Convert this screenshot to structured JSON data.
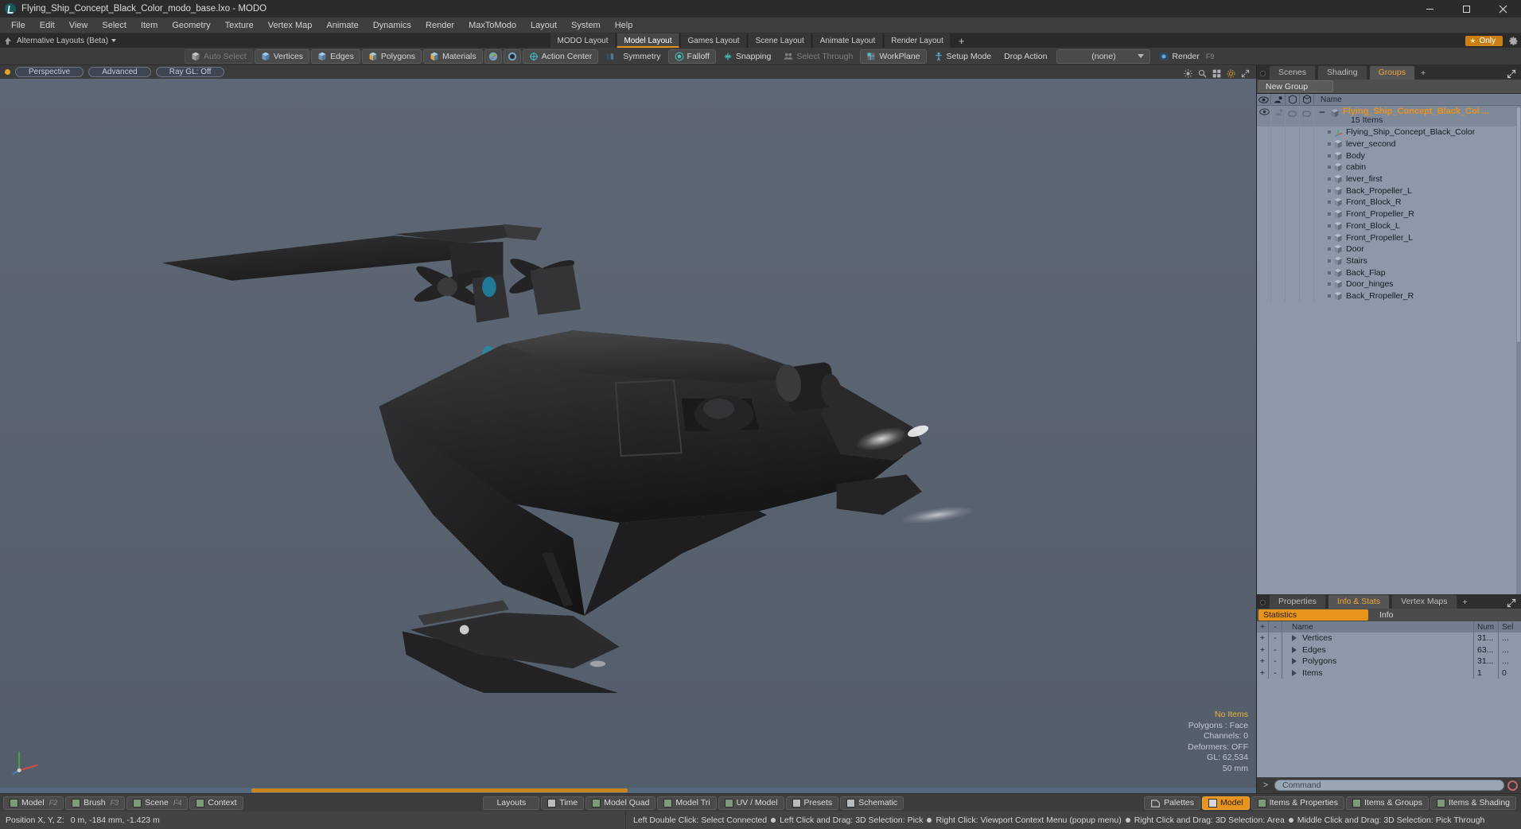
{
  "titlebar": {
    "title": "Flying_Ship_Concept_Black_Color_modo_base.lxo - MODO",
    "minimize": "—",
    "maximize": "❐",
    "close": "✕"
  },
  "menubar": {
    "items": [
      "File",
      "Edit",
      "View",
      "Select",
      "Item",
      "Geometry",
      "Texture",
      "Vertex Map",
      "Animate",
      "Dynamics",
      "Render",
      "MaxToModo",
      "Layout",
      "System",
      "Help"
    ]
  },
  "layoutbar": {
    "alt_layouts": "Alternative Layouts (Beta)",
    "tabs": [
      {
        "label": "MODO Layout",
        "active": false
      },
      {
        "label": "Model Layout",
        "active": true
      },
      {
        "label": "Games Layout",
        "active": false
      },
      {
        "label": "Scene Layout",
        "active": false
      },
      {
        "label": "Animate Layout",
        "active": false
      },
      {
        "label": "Render Layout",
        "active": false
      }
    ],
    "add_tab": "+",
    "only_label": "Only",
    "accent": "#e8901a"
  },
  "modebar": {
    "buttons": [
      {
        "label": "Auto Select",
        "dim": true,
        "icon": "cube-grey-icon"
      },
      {
        "label": "Vertices",
        "dim": false,
        "icon": "cube-blue-icon"
      },
      {
        "label": "Edges",
        "dim": false,
        "icon": "cube-blue-icon"
      },
      {
        "label": "Polygons",
        "dim": false,
        "icon": "cube-blue-icon"
      },
      {
        "label": "Materials",
        "dim": false,
        "icon": "cube-blue-icon"
      }
    ],
    "small_icons": [
      "sphere-red-icon",
      "sphere-dark-icon"
    ],
    "action_center": "Action Center",
    "symmetry": "Symmetry",
    "falloff": "Falloff",
    "snapping": "Snapping",
    "select_through": "Select Through",
    "workplane": "WorkPlane",
    "setup_mode": "Setup Mode",
    "drop_action_label": "Drop Action",
    "drop_action_value": "(none)",
    "render": "Render",
    "render_key": "F9"
  },
  "viewport": {
    "mode": "Perspective",
    "shading": "Advanced",
    "raygl": "Ray GL: Off",
    "overlay": {
      "no_items": "No Items",
      "polygons": "Polygons : Face",
      "channels": "Channels: 0",
      "deformers": "Deformers: OFF",
      "gl": "GL: 62,534",
      "grid": "50 mm"
    }
  },
  "rightpanel": {
    "tabs": [
      {
        "label": "Scenes",
        "active": false
      },
      {
        "label": "Shading",
        "active": false
      },
      {
        "label": "Groups",
        "active": true
      }
    ],
    "add_tab": "+",
    "new_group": "New Group",
    "list_header": {
      "name": "Name"
    },
    "group": {
      "name": "Flying_Ship_Concept_Black_Col ...",
      "count": "15 Items",
      "color": "#e8921e"
    },
    "items": [
      {
        "label": "Flying_Ship_Concept_Black_Color",
        "icon": "locator-axis-icon"
      },
      {
        "label": "lever_second",
        "icon": "mesh-icon"
      },
      {
        "label": "Body",
        "icon": "mesh-icon"
      },
      {
        "label": "cabin",
        "icon": "mesh-icon"
      },
      {
        "label": "lever_first",
        "icon": "mesh-icon"
      },
      {
        "label": "Back_Propeller_L",
        "icon": "mesh-icon"
      },
      {
        "label": "Front_Block_R",
        "icon": "mesh-icon"
      },
      {
        "label": "Front_Propeller_R",
        "icon": "mesh-icon"
      },
      {
        "label": "Front_Block_L",
        "icon": "mesh-icon"
      },
      {
        "label": "Front_Propeller_L",
        "icon": "mesh-icon"
      },
      {
        "label": "Door",
        "icon": "mesh-icon"
      },
      {
        "label": "Stairs",
        "icon": "mesh-icon"
      },
      {
        "label": "Back_Flap",
        "icon": "mesh-icon"
      },
      {
        "label": "Door_hinges",
        "icon": "mesh-icon"
      },
      {
        "label": "Back_Rropeller_R",
        "icon": "mesh-icon"
      }
    ]
  },
  "statspanel": {
    "tabs": [
      {
        "label": "Properties",
        "active": false
      },
      {
        "label": "Info & Stats",
        "active": true
      },
      {
        "label": "Vertex Maps",
        "active": false
      }
    ],
    "add_tab": "+",
    "subtabs": {
      "statistics": "Statistics",
      "info": "Info"
    },
    "columns": {
      "plus": "+",
      "minus": "-",
      "name": "Name",
      "num": "Num",
      "sel": "Sel"
    },
    "rows": [
      {
        "plus": "+",
        "minus": "-",
        "name": "Vertices",
        "num": "31...",
        "sel": "..."
      },
      {
        "plus": "+",
        "minus": "-",
        "name": "Edges",
        "num": "63...",
        "sel": "..."
      },
      {
        "plus": "+",
        "minus": "-",
        "name": "Polygons",
        "num": "31...",
        "sel": "..."
      },
      {
        "plus": "+",
        "minus": "-",
        "name": "Items",
        "num": "1",
        "sel": "0"
      }
    ]
  },
  "commandbar": {
    "prompt": ">",
    "placeholder": "Command",
    "value": "Command"
  },
  "bottombar": {
    "left": [
      {
        "label": "Model",
        "key": "F2",
        "swatch": "green"
      },
      {
        "label": "Brush",
        "key": "F3",
        "swatch": "green"
      },
      {
        "label": "Scene",
        "key": "F4",
        "swatch": "green"
      },
      {
        "label": "Context",
        "key": "",
        "swatch": "green"
      }
    ],
    "center": [
      {
        "label": "Layouts",
        "swatch": ""
      },
      {
        "label": "Time",
        "swatch": "grey"
      },
      {
        "label": "Model Quad",
        "swatch": "green"
      },
      {
        "label": "Model Tri",
        "swatch": "green"
      },
      {
        "label": "UV / Model",
        "swatch": "green"
      },
      {
        "label": "Presets",
        "swatch": "grey"
      },
      {
        "label": "Schematic",
        "swatch": "grey"
      }
    ],
    "right": [
      {
        "label": "Palettes",
        "swatch": "palette",
        "active": false
      },
      {
        "label": "Model",
        "swatch": "ogrey",
        "active": true
      },
      {
        "label": "Items & Properties",
        "swatch": "green",
        "active": false
      },
      {
        "label": "Items & Groups",
        "swatch": "green",
        "active": false
      },
      {
        "label": "Items & Shading",
        "swatch": "green",
        "active": false
      }
    ]
  },
  "statusbar": {
    "position_label": "Position X, Y, Z:",
    "position_value": "0 m, -184 mm, -1.423 m",
    "hints": [
      "Left Double Click: Select Connected",
      "Left Click and Drag: 3D Selection: Pick",
      "Right Click: Viewport Context Menu (popup menu)",
      "Right Click and Drag: 3D Selection: Area",
      "Middle Click and Drag: 3D Selection: Pick Through"
    ]
  }
}
